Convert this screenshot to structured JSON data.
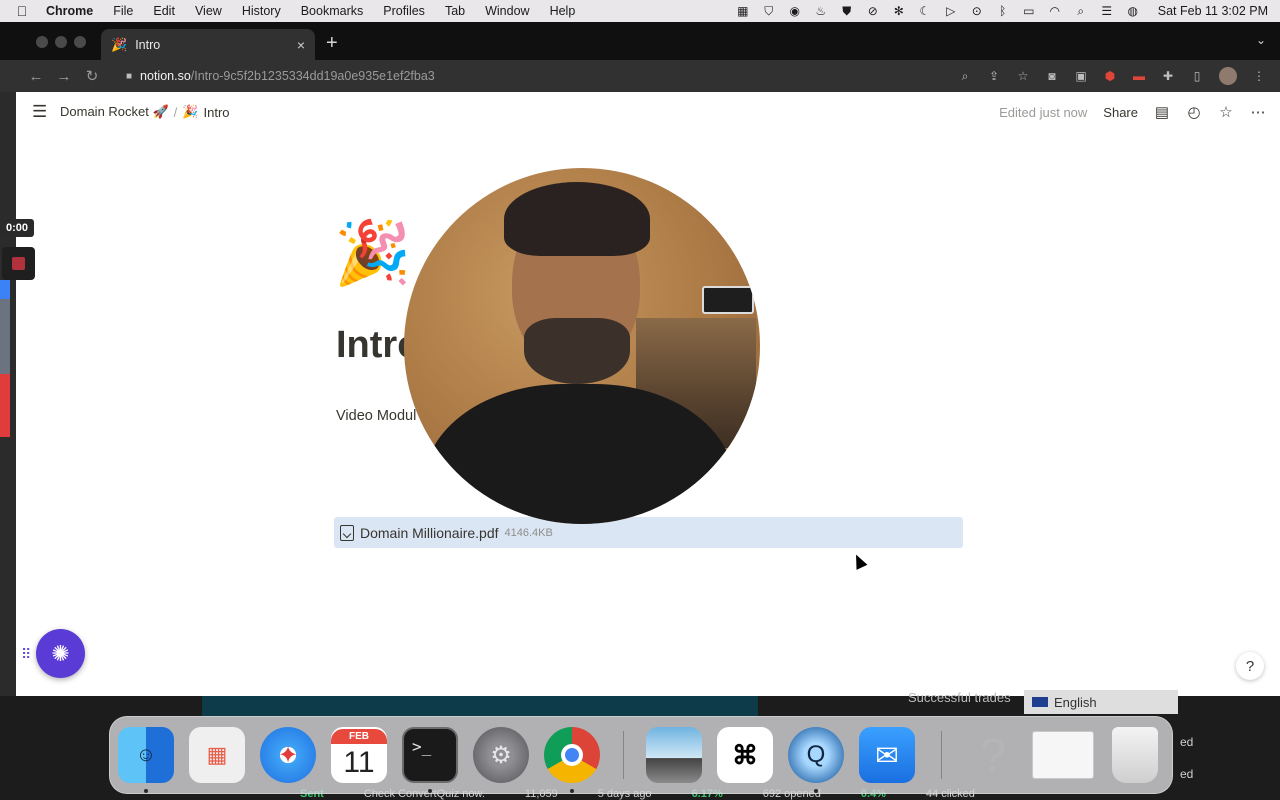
{
  "menubar": {
    "apple": "",
    "items": [
      "Chrome",
      "File",
      "Edit",
      "View",
      "History",
      "Bookmarks",
      "Profiles",
      "Tab",
      "Window",
      "Help"
    ],
    "clock": "Sat Feb 11  3:02 PM"
  },
  "browser": {
    "tab": {
      "icon": "🎉",
      "title": "Intro",
      "close": "×"
    },
    "new_tab": "+",
    "tab_menu": "⌄",
    "nav": {
      "back": "←",
      "forward": "→",
      "reload": "↻"
    },
    "url": {
      "host": "notion.so",
      "path": "/Intro-9c5f2b1235334dd19a0e935e1ef2fba3"
    },
    "colors": {
      "toolbar": "#313131",
      "tabstrip": "#101010"
    }
  },
  "notion": {
    "breadcrumb": {
      "workspace": "Domain Rocket 🚀",
      "separator": "/",
      "page_icon": "🎉",
      "page": "Intro"
    },
    "edited": "Edited just now",
    "share": "Share",
    "page_emoji": "🎉",
    "title": "Intro",
    "body_text": "Video Modul",
    "file": {
      "name": "Domain Millionaire.pdf",
      "size": "4146.4KB"
    },
    "help": "?"
  },
  "recorder": {
    "time": "0:00",
    "accent": "#b1323d"
  },
  "background": {
    "trades": "Successful trades",
    "language": "English",
    "right_col": [
      "ed",
      "ed"
    ],
    "bottom": [
      "Sent",
      "Check ConvertQuiz now.",
      "11,059",
      "5 days ago",
      "6.17%",
      "692 opened",
      "0.4%",
      "44 clicked"
    ]
  },
  "dock": {
    "calendar_month": "FEB",
    "calendar_day": "11",
    "terminal_prompt": ">_",
    "help_glyph": "?"
  }
}
